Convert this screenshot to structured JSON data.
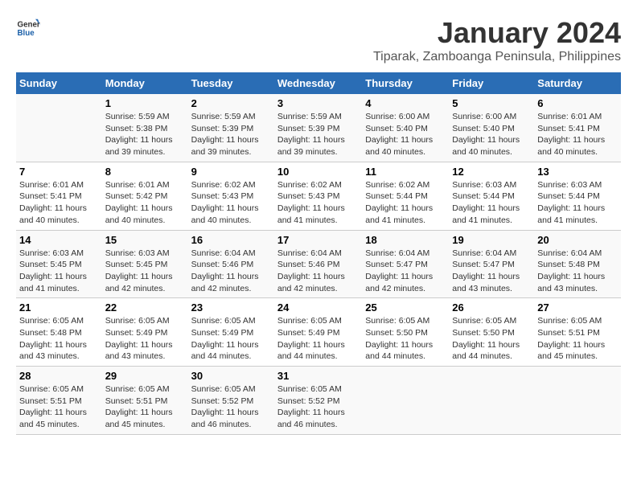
{
  "logo": {
    "general": "General",
    "blue": "Blue"
  },
  "title": "January 2024",
  "subtitle": "Tiparak, Zamboanga Peninsula, Philippines",
  "headers": [
    "Sunday",
    "Monday",
    "Tuesday",
    "Wednesday",
    "Thursday",
    "Friday",
    "Saturday"
  ],
  "weeks": [
    [
      {
        "day": "",
        "text": ""
      },
      {
        "day": "1",
        "text": "Sunrise: 5:59 AM\nSunset: 5:38 PM\nDaylight: 11 hours\nand 39 minutes."
      },
      {
        "day": "2",
        "text": "Sunrise: 5:59 AM\nSunset: 5:39 PM\nDaylight: 11 hours\nand 39 minutes."
      },
      {
        "day": "3",
        "text": "Sunrise: 5:59 AM\nSunset: 5:39 PM\nDaylight: 11 hours\nand 39 minutes."
      },
      {
        "day": "4",
        "text": "Sunrise: 6:00 AM\nSunset: 5:40 PM\nDaylight: 11 hours\nand 40 minutes."
      },
      {
        "day": "5",
        "text": "Sunrise: 6:00 AM\nSunset: 5:40 PM\nDaylight: 11 hours\nand 40 minutes."
      },
      {
        "day": "6",
        "text": "Sunrise: 6:01 AM\nSunset: 5:41 PM\nDaylight: 11 hours\nand 40 minutes."
      }
    ],
    [
      {
        "day": "7",
        "text": "Sunrise: 6:01 AM\nSunset: 5:41 PM\nDaylight: 11 hours\nand 40 minutes."
      },
      {
        "day": "8",
        "text": "Sunrise: 6:01 AM\nSunset: 5:42 PM\nDaylight: 11 hours\nand 40 minutes."
      },
      {
        "day": "9",
        "text": "Sunrise: 6:02 AM\nSunset: 5:43 PM\nDaylight: 11 hours\nand 40 minutes."
      },
      {
        "day": "10",
        "text": "Sunrise: 6:02 AM\nSunset: 5:43 PM\nDaylight: 11 hours\nand 41 minutes."
      },
      {
        "day": "11",
        "text": "Sunrise: 6:02 AM\nSunset: 5:44 PM\nDaylight: 11 hours\nand 41 minutes."
      },
      {
        "day": "12",
        "text": "Sunrise: 6:03 AM\nSunset: 5:44 PM\nDaylight: 11 hours\nand 41 minutes."
      },
      {
        "day": "13",
        "text": "Sunrise: 6:03 AM\nSunset: 5:44 PM\nDaylight: 11 hours\nand 41 minutes."
      }
    ],
    [
      {
        "day": "14",
        "text": "Sunrise: 6:03 AM\nSunset: 5:45 PM\nDaylight: 11 hours\nand 41 minutes."
      },
      {
        "day": "15",
        "text": "Sunrise: 6:03 AM\nSunset: 5:45 PM\nDaylight: 11 hours\nand 42 minutes."
      },
      {
        "day": "16",
        "text": "Sunrise: 6:04 AM\nSunset: 5:46 PM\nDaylight: 11 hours\nand 42 minutes."
      },
      {
        "day": "17",
        "text": "Sunrise: 6:04 AM\nSunset: 5:46 PM\nDaylight: 11 hours\nand 42 minutes."
      },
      {
        "day": "18",
        "text": "Sunrise: 6:04 AM\nSunset: 5:47 PM\nDaylight: 11 hours\nand 42 minutes."
      },
      {
        "day": "19",
        "text": "Sunrise: 6:04 AM\nSunset: 5:47 PM\nDaylight: 11 hours\nand 43 minutes."
      },
      {
        "day": "20",
        "text": "Sunrise: 6:04 AM\nSunset: 5:48 PM\nDaylight: 11 hours\nand 43 minutes."
      }
    ],
    [
      {
        "day": "21",
        "text": "Sunrise: 6:05 AM\nSunset: 5:48 PM\nDaylight: 11 hours\nand 43 minutes."
      },
      {
        "day": "22",
        "text": "Sunrise: 6:05 AM\nSunset: 5:49 PM\nDaylight: 11 hours\nand 43 minutes."
      },
      {
        "day": "23",
        "text": "Sunrise: 6:05 AM\nSunset: 5:49 PM\nDaylight: 11 hours\nand 44 minutes."
      },
      {
        "day": "24",
        "text": "Sunrise: 6:05 AM\nSunset: 5:49 PM\nDaylight: 11 hours\nand 44 minutes."
      },
      {
        "day": "25",
        "text": "Sunrise: 6:05 AM\nSunset: 5:50 PM\nDaylight: 11 hours\nand 44 minutes."
      },
      {
        "day": "26",
        "text": "Sunrise: 6:05 AM\nSunset: 5:50 PM\nDaylight: 11 hours\nand 44 minutes."
      },
      {
        "day": "27",
        "text": "Sunrise: 6:05 AM\nSunset: 5:51 PM\nDaylight: 11 hours\nand 45 minutes."
      }
    ],
    [
      {
        "day": "28",
        "text": "Sunrise: 6:05 AM\nSunset: 5:51 PM\nDaylight: 11 hours\nand 45 minutes."
      },
      {
        "day": "29",
        "text": "Sunrise: 6:05 AM\nSunset: 5:51 PM\nDaylight: 11 hours\nand 45 minutes."
      },
      {
        "day": "30",
        "text": "Sunrise: 6:05 AM\nSunset: 5:52 PM\nDaylight: 11 hours\nand 46 minutes."
      },
      {
        "day": "31",
        "text": "Sunrise: 6:05 AM\nSunset: 5:52 PM\nDaylight: 11 hours\nand 46 minutes."
      },
      {
        "day": "",
        "text": ""
      },
      {
        "day": "",
        "text": ""
      },
      {
        "day": "",
        "text": ""
      }
    ]
  ]
}
